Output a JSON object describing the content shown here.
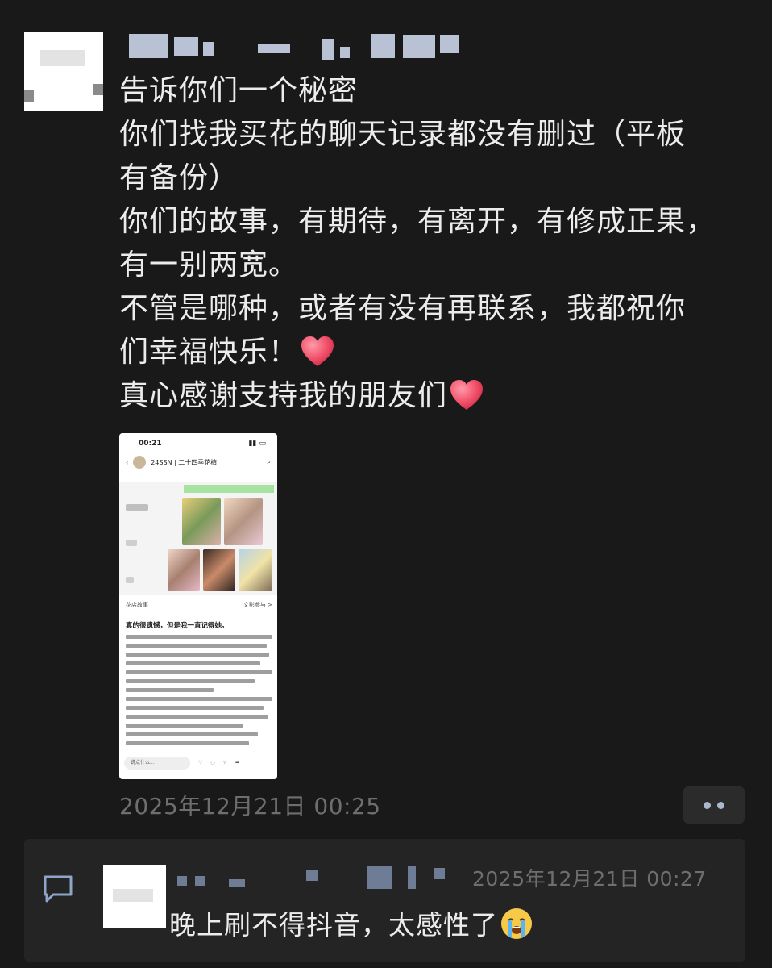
{
  "post": {
    "lines": [
      "告诉你们一个秘密",
      "你们找我买花的聊天记录都没有删过（平板",
      "有备份）",
      "你们的故事，有期待，有离开，有修成正果，",
      "有一别两宽。",
      "不管是哪种，或者有没有再联系，我都祝你",
      "们幸福快乐！",
      "真心感谢支持我的朋友们"
    ],
    "timestamp": "2025年12月21日 00:25"
  },
  "screenshot": {
    "status_time": "00:21",
    "header_title": "24SSN | 二十四季花植",
    "story_header_label": "花店故事",
    "story_header_link": "文影参与 >",
    "story_title": "真的很遗憾，但是我一直记得她。",
    "comment_placeholder": "说点什么..."
  },
  "comment": {
    "time": "2025年12月21日 00:27",
    "text": "晚上刷不得抖音，太感性了"
  },
  "icons": {
    "heart": "red-heart-emoji",
    "cry": "crying-face-emoji",
    "comment": "comment-bubble-icon",
    "more": "more-dots-icon"
  },
  "colors": {
    "background": "#191919",
    "text": "#ececec",
    "muted": "#6e6e6e",
    "heart": "#f2556e",
    "accent": "#aab7cc"
  }
}
